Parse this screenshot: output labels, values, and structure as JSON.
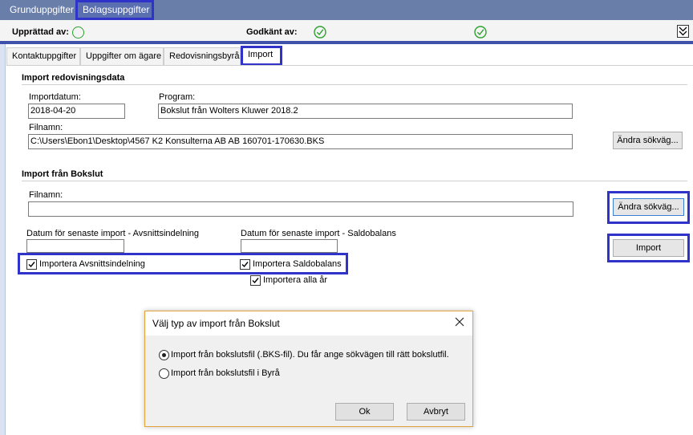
{
  "top_tabs": [
    "Grunduppgifter",
    "Bolagsuppgifter"
  ],
  "status": {
    "prepared_label": "Upprättad av:",
    "approved_label": "Godkänt av:"
  },
  "tabs": [
    "Kontaktuppgifter",
    "Uppgifter om ägare",
    "Redovisningsbyrå",
    "Import"
  ],
  "import_data": {
    "title": "Import redovisningsdata",
    "date_label": "Importdatum:",
    "date_value": "2018-04-20",
    "program_label": "Program:",
    "program_value": "Bokslut från Wolters Kluwer 2018.2",
    "filename_label": "Filnamn:",
    "filename_value": "C:\\Users\\Ebon1\\Desktop\\4567 K2 Konsulterna AB AB 160701-170630.BKS",
    "change_path_button": "Ändra sökväg..."
  },
  "bokslut": {
    "title": "Import från Bokslut",
    "filename_label": "Filnamn:",
    "filename_value": "",
    "change_path_button": "Ändra sökväg...",
    "date_avsnitt_label": "Datum för senaste import - Avsnittsindelning",
    "date_saldo_label": "Datum för senaste import - Saldobalans",
    "import_button": "Import",
    "chk_avsnitt": "Importera Avsnittsindelning",
    "chk_saldo": "Importera Saldobalans",
    "chk_all_years": "Importera alla år"
  },
  "dialog": {
    "title": "Välj typ av import från Bokslut",
    "option1": "Import från bokslutsfil (.BKS-fil). Du får ange sökvägen till rätt bokslutfil.",
    "option2": "Import från bokslutsfil i Byrå",
    "ok": "Ok",
    "cancel": "Avbryt"
  },
  "colors": {
    "topbar": "#6a7eaa",
    "highlight": "#2f33c9",
    "status_green": "#2da12d",
    "dialog_border": "#e2a33a"
  }
}
